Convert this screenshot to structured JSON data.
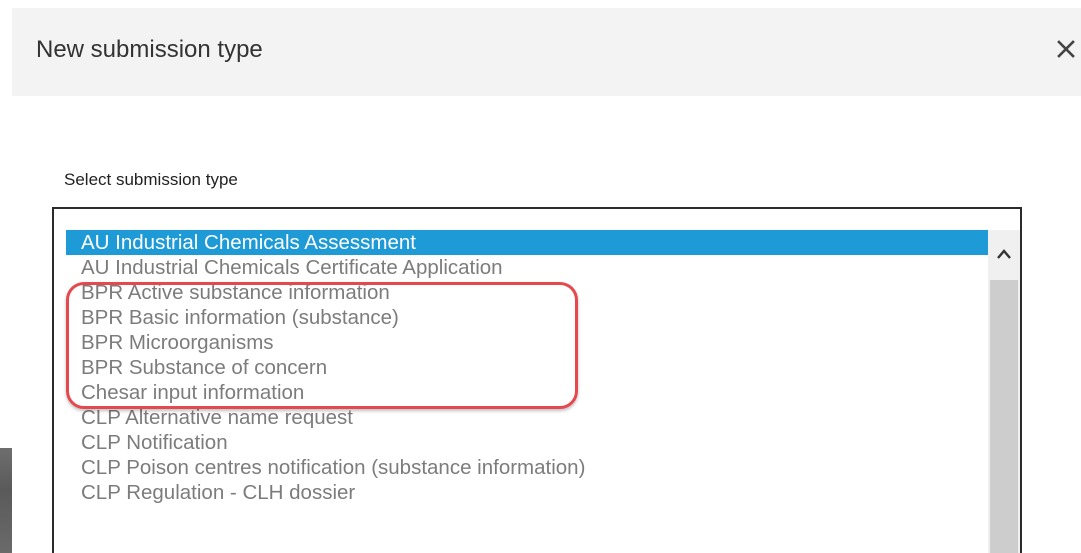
{
  "dialog": {
    "title": "New submission type",
    "close_icon": "close-icon"
  },
  "field": {
    "label": "Select submission type"
  },
  "options": [
    {
      "label": "AU Industrial Chemicals Assessment",
      "selected": true
    },
    {
      "label": "AU Industrial Chemicals Certificate Application",
      "selected": false
    },
    {
      "label": "BPR Active substance information",
      "selected": false
    },
    {
      "label": "BPR Basic information (substance)",
      "selected": false
    },
    {
      "label": "BPR Microorganisms",
      "selected": false
    },
    {
      "label": "BPR Substance of concern",
      "selected": false
    },
    {
      "label": "Chesar input information",
      "selected": false
    },
    {
      "label": "CLP Alternative name request",
      "selected": false
    },
    {
      "label": "CLP Notification",
      "selected": false
    },
    {
      "label": "CLP Poison centres notification (substance information)",
      "selected": false
    },
    {
      "label": "CLP Regulation - CLH dossier",
      "selected": false
    }
  ],
  "colors": {
    "selected_bg": "#1e9ad6",
    "option_text": "#7c7c7c",
    "annotation": "#e5484d"
  },
  "scrollbar": {
    "up_icon": "chevron-up-icon"
  }
}
